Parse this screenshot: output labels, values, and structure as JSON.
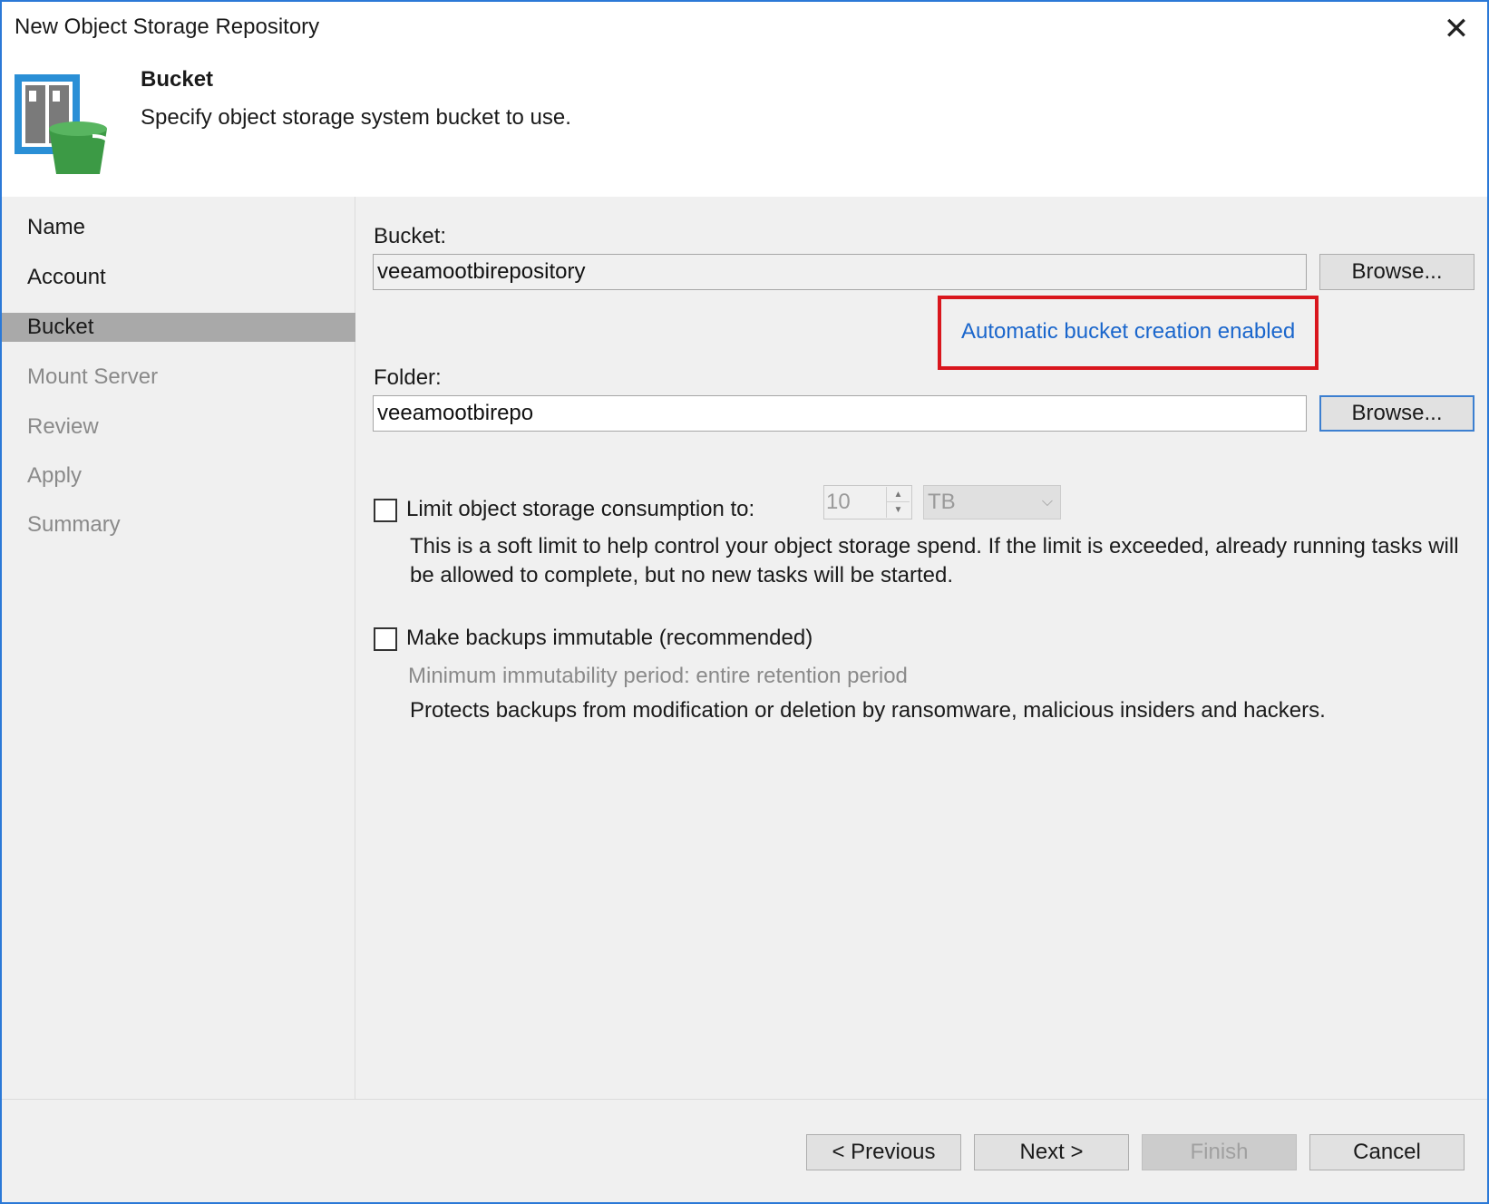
{
  "window": {
    "title": "New Object Storage Repository",
    "close_glyph": "✕"
  },
  "header": {
    "step_title": "Bucket",
    "step_description": "Specify object storage system bucket to use.",
    "logo_icon": "object-storage-bucket-icon"
  },
  "sidebar": {
    "items": [
      {
        "label": "Name",
        "state": "normal"
      },
      {
        "label": "Account",
        "state": "normal"
      },
      {
        "label": "Bucket",
        "state": "active"
      },
      {
        "label": "Mount Server",
        "state": "disabled"
      },
      {
        "label": "Review",
        "state": "disabled"
      },
      {
        "label": "Apply",
        "state": "disabled"
      },
      {
        "label": "Summary",
        "state": "disabled"
      }
    ]
  },
  "bucket": {
    "label": "Bucket:",
    "value": "veeamootbirepository",
    "browse_label": "Browse...",
    "auto_creation_link": "Automatic bucket creation enabled"
  },
  "folder": {
    "label": "Folder:",
    "value": "veeamootbirepo",
    "browse_label": "Browse..."
  },
  "limit": {
    "checkbox_label": "Limit object storage consumption to:",
    "checked": false,
    "amount": "10",
    "unit": "TB",
    "description": "This is a soft limit to help control your object storage spend. If the limit is exceeded, already running tasks will be allowed to complete, but no new tasks will be started."
  },
  "immutable": {
    "checkbox_label": "Make backups immutable (recommended)",
    "checked": false,
    "period_text": "Minimum immutability period: entire retention period",
    "description": "Protects backups from modification or deletion by ransomware, malicious insiders and hackers."
  },
  "footer": {
    "previous_label": "< Previous",
    "next_label": "Next >",
    "finish_label": "Finish",
    "cancel_label": "Cancel"
  },
  "colors": {
    "window_border": "#2b79d7",
    "active_nav": "#a9a9a9",
    "link": "#1a66cc",
    "highlight": "#d9161d",
    "bucket_green": "#3c9a45"
  }
}
